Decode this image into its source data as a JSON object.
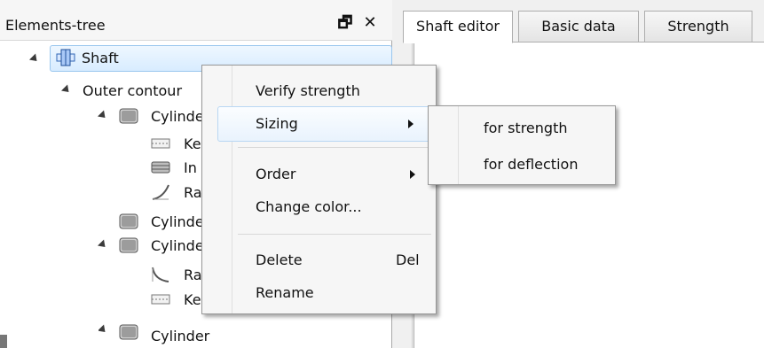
{
  "panel": {
    "title": "Elements-tree",
    "float_icon": "🗗",
    "close_icon": "✕"
  },
  "tree": [
    {
      "label": "Shaft",
      "icon": "shaft-icon",
      "selected": true
    },
    {
      "label": "Outer contour",
      "icon": ""
    },
    {
      "label": "Cylinder",
      "icon": "cylinder-icon"
    },
    {
      "label": "Ke",
      "icon": "key-icon"
    },
    {
      "label": "In",
      "icon": "insert-icon"
    },
    {
      "label": "Ra",
      "icon": "radius-icon"
    },
    {
      "label": "Cylinder",
      "icon": "cylinder-icon"
    },
    {
      "label": "Cylinder",
      "icon": "cylinder-icon"
    },
    {
      "label": "Ra",
      "icon": "radius-icon"
    },
    {
      "label": "Key",
      "icon": "key-icon"
    },
    {
      "label": "Cylinder",
      "icon": "cylinder-icon"
    }
  ],
  "tabs": [
    {
      "label": "Shaft editor",
      "active": true
    },
    {
      "label": "Basic data",
      "active": false
    },
    {
      "label": "Strength",
      "active": false
    }
  ],
  "context_menu": {
    "items": [
      {
        "label": "Verify strength",
        "shortcut": "",
        "submenu": false
      },
      {
        "label": "Sizing",
        "shortcut": "",
        "submenu": true
      },
      {
        "label": "Order",
        "shortcut": "",
        "submenu": true
      },
      {
        "label": "Change color...",
        "shortcut": "",
        "submenu": false
      },
      {
        "label": "Delete",
        "shortcut": "Del",
        "submenu": false
      },
      {
        "label": "Rename",
        "shortcut": "",
        "submenu": false
      }
    ]
  },
  "submenu": {
    "items": [
      {
        "label": "for strength"
      },
      {
        "label": "for deflection"
      }
    ]
  }
}
